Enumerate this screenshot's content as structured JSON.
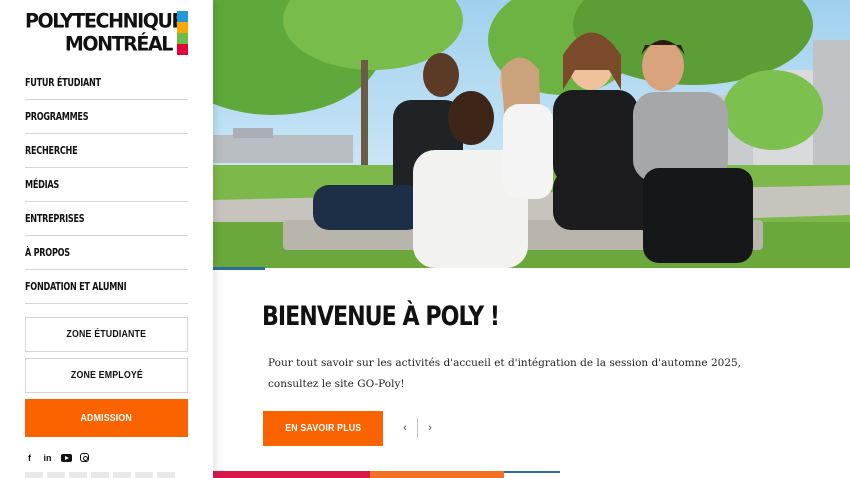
{
  "logo": {
    "line1": "POLYTECHNIQUE",
    "line2": "MONTRÉAL",
    "bar_colors": [
      "#1f9bd7",
      "#f6a800",
      "#6bbd45",
      "#e4003b"
    ]
  },
  "nav": {
    "items": [
      {
        "label": "FUTUR ÉTUDIANT"
      },
      {
        "label": "PROGRAMMES"
      },
      {
        "label": "RECHERCHE"
      },
      {
        "label": "MÉDIAS"
      },
      {
        "label": "ENTREPRISES"
      },
      {
        "label": "À PROPOS"
      },
      {
        "label": "FONDATION ET ALUMNI"
      }
    ]
  },
  "zones": {
    "student": "ZONE ÉTUDIANTE",
    "employee": "ZONE EMPLOYÉ",
    "admission": "ADMISSION"
  },
  "social": {
    "facebook": "f",
    "linkedin": "in",
    "icons": [
      "facebook-icon",
      "linkedin-icon",
      "youtube-icon",
      "instagram-icon"
    ]
  },
  "hero": {
    "image": "students-seated-outdoors-photo"
  },
  "content": {
    "title": "BIENVENUE À POLY !",
    "paragraph_line1": "Pour tout savoir sur les activités d'accueil et d'intégration de la session d'automne 2025,",
    "paragraph_line2": "consultez le site GO-Poly!",
    "cta_label": "EN SAVOIR PLUS",
    "prev_arrow": "‹",
    "next_arrow": "›"
  },
  "colors": {
    "accent_orange": "#fb6200",
    "stripe_red": "#d8194a",
    "stripe_orange": "#f36f21",
    "stripe_blue": "#2a6fa0"
  }
}
